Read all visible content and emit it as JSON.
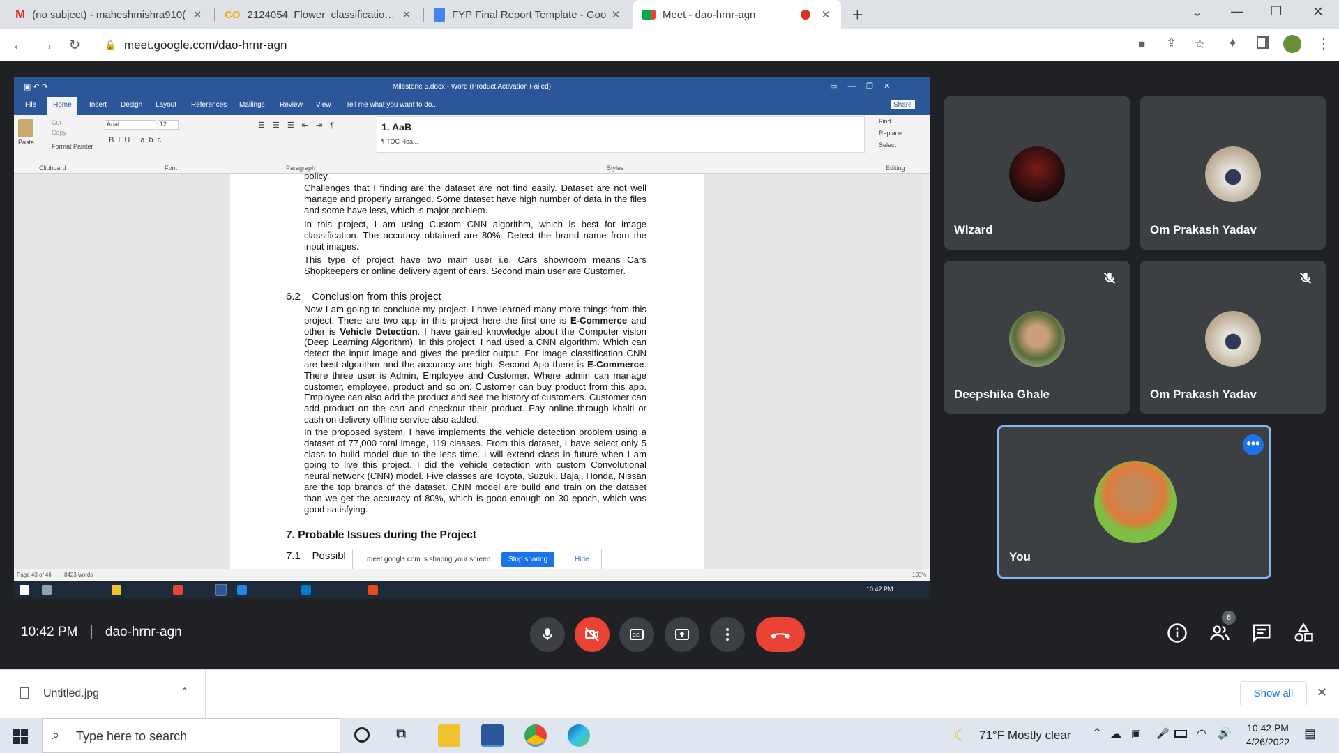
{
  "browser": {
    "tabs": [
      {
        "title": "(no subject) - maheshmishra910(",
        "icon": "gmail-icon"
      },
      {
        "title": "2124054_Flower_classification.ipy",
        "icon": "colab-icon"
      },
      {
        "title": "FYP Final Report Template - Goo",
        "icon": "docs-icon"
      },
      {
        "title": "Meet - dao-hrnr-agn",
        "icon": "meet-icon"
      }
    ],
    "url": "meet.google.com/dao-hrnr-agn"
  },
  "word": {
    "title": "Milestone 5.docx - Word (Product Activation Failed)",
    "tabs": [
      "File",
      "Home",
      "Insert",
      "Design",
      "Layout",
      "References",
      "Mailings",
      "Review",
      "View"
    ],
    "tell_me": "Tell me what you want to do...",
    "share": "Share",
    "clipboard": {
      "cut": "Cut",
      "copy": "Copy",
      "paste": "Paste",
      "painter": "Format Painter",
      "group": "Clipboard"
    },
    "font_name": "Arial",
    "font_size": "12",
    "font_group": "Font",
    "paragraph_group": "Paragraph",
    "styles": {
      "style1": "1. AaB",
      "style2": "¶ TOC Hea...",
      "group": "Styles"
    },
    "editing": {
      "find": "Find",
      "replace": "Replace",
      "select": "Select",
      "group": "Editing"
    },
    "doc": {
      "p0": "policy.",
      "p1": "Challenges that I finding are the dataset are not find easily. Dataset are not well manage and properly arranged. Some dataset have high number of data in the files and some have less, which is major problem.",
      "p2": "In this project, I am using Custom CNN algorithm, which is best for image classification. The accuracy obtained are 80%. Detect the brand name from the input images.",
      "p3": "This type of project have two main user i.e. Cars showroom means Cars Shopkeepers or online delivery agent of cars. Second main user are Customer.",
      "h62num": "6.2",
      "h62": "Conclusion from this project",
      "p4a": "Now I am going to conclude my project. I have learned many more things from this project. There are two app in this project here the first one is ",
      "p4b": "E-Commerce",
      "p4c": " and other is ",
      "p4d": "Vehicle Detection",
      "p4e": ". I have gained knowledge about the Computer vision (Deep Learning Algorithm). In this project, I had used a CNN algorithm. Which can detect the input image and gives the predict output. For image classification CNN are best algorithm and the accuracy are high. Second App there is ",
      "p4f": "E-Commerce",
      "p4g": ". There three user is Admin, Employee and Customer. Where admin can manage customer, employee, product and so on. Customer can buy product from this app. Employee can also add the product and see the history of customers. Customer can add product on the cart and checkout their product. Pay online through khalti or cash on delivery offline service also added.",
      "p5": "In the proposed system, I have implements the vehicle detection problem using a dataset of 77,000 total image, 119 classes. From this dataset, I have select only 5 class to build model due to the less time. I will extend class in future when I am going to live this project. I did the vehicle detection with custom Convolutional neural network (CNN) model. Five classes are Toyota, Suzuki, Bajaj, Honda, Nissan are the top brands of the dataset. CNN model are build and train on the dataset than we get the accuracy of 80%, which is good enough on 30 epoch, which was good satisfying.",
      "h7": "7.  Probable Issues during the Project",
      "h71num": "7.1",
      "h71": "Possibl"
    },
    "status": {
      "page": "Page 43 of 46",
      "words": "8423 words",
      "zoom": "100%"
    },
    "share_notice": "meet.google.com is sharing your screen.",
    "stop_sharing": "Stop sharing",
    "hide": "Hide",
    "taskbar_time": "10:42 PM"
  },
  "participants": [
    {
      "name": "Wizard",
      "muted": false
    },
    {
      "name": "Om Prakash Yadav",
      "muted": false
    },
    {
      "name": "Deepshika Ghale",
      "muted": true
    },
    {
      "name": "Om Prakash Yadav",
      "muted": true
    },
    {
      "name": "You",
      "muted": false
    }
  ],
  "meeting": {
    "time": "10:42 PM",
    "code": "dao-hrnr-agn",
    "people_count": "6"
  },
  "download": {
    "file": "Untitled.jpg",
    "show_all": "Show all"
  },
  "taskbar": {
    "search": "Type here to search",
    "weather": "71°F  Mostly clear",
    "time": "10:42 PM",
    "date": "4/26/2022"
  }
}
